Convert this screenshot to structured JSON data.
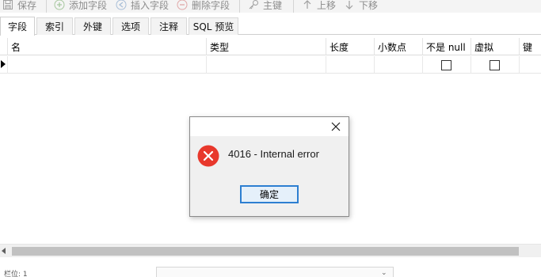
{
  "toolbar": {
    "save": "保存",
    "add_field": "添加字段",
    "insert_field": "插入字段",
    "delete_field": "删除字段",
    "primary_key": "主键",
    "move_up": "上移",
    "move_down": "下移"
  },
  "tabs": [
    "字段",
    "索引",
    "外键",
    "选项",
    "注释",
    "SQL 预览"
  ],
  "grid": {
    "columns": [
      "名",
      "类型",
      "长度",
      "小数点",
      "不是 null",
      "虚拟",
      "键"
    ]
  },
  "dialog": {
    "message": "4016 - Internal error",
    "ok_label": "确定"
  },
  "status": {
    "left_text": "栏位: 1"
  }
}
